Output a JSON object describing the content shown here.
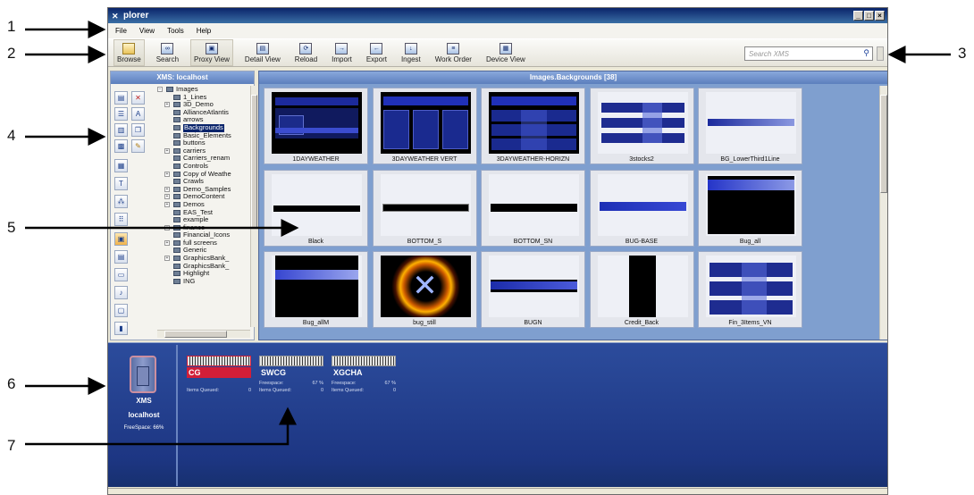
{
  "window": {
    "title": "plorer",
    "controls": [
      "_",
      "□",
      "×"
    ]
  },
  "menu": [
    "File",
    "View",
    "Tools",
    "Help"
  ],
  "toolbar": {
    "buttons": [
      "Browse",
      "Search",
      "Proxy View",
      "Detail View",
      "Reload",
      "Import",
      "Export",
      "Ingest",
      "Work Order",
      "Device View"
    ],
    "search_placeholder": "Search XMS"
  },
  "left_panel": {
    "header": "XMS: localhost",
    "tree": [
      "Images",
      "1_Lines",
      "3D_Demo",
      "AllianceAtlantis",
      "arrows",
      "Backgrounds",
      "Basic_Elements",
      "buttons",
      "carriers",
      "Carriers_renam",
      "Controls",
      "Copy of Weathe",
      "Crawls",
      "Demo_Samples",
      "DemoContent",
      "Demos",
      "EAS_Test",
      "example",
      "finance",
      "Financial_Icons",
      "full screens",
      "Generic",
      "GraphicsBank_",
      "GraphicsBank_",
      "Highlight",
      "ING"
    ]
  },
  "main_panel": {
    "header": "Images.Backgrounds [38]",
    "tiles": [
      "1DAYWEATHER",
      "3DAYWEATHER VERT",
      "3DAYWEATHER-HORIZN",
      "3stocks2",
      "BG_LowerThird1Line",
      "Black",
      "BOTTOM_S",
      "BOTTOM_SN",
      "BUG-BASE",
      "Bug_all",
      "Bug_allM",
      "bug_still",
      "BUGN",
      "Credit_Back",
      "Fin_3Items_VN"
    ]
  },
  "device_pane": {
    "xms": {
      "name": "XMS",
      "host": "localhost",
      "freespace": "FreeSpace: 66%"
    },
    "devices": [
      {
        "name": "CG",
        "freespace_label": "",
        "freespace_value": "",
        "queued_label": "Items Queued:",
        "queued_value": "0"
      },
      {
        "name": "SWCG",
        "freespace_label": "Freespace:",
        "freespace_value": "67 %",
        "queued_label": "Items Queued:",
        "queued_value": "0"
      },
      {
        "name": "XGCHA",
        "freespace_label": "Freespace:",
        "freespace_value": "67 %",
        "queued_label": "Items Queued:",
        "queued_value": "0"
      }
    ]
  },
  "callouts": [
    "1",
    "2",
    "3",
    "4",
    "5",
    "6",
    "7"
  ]
}
